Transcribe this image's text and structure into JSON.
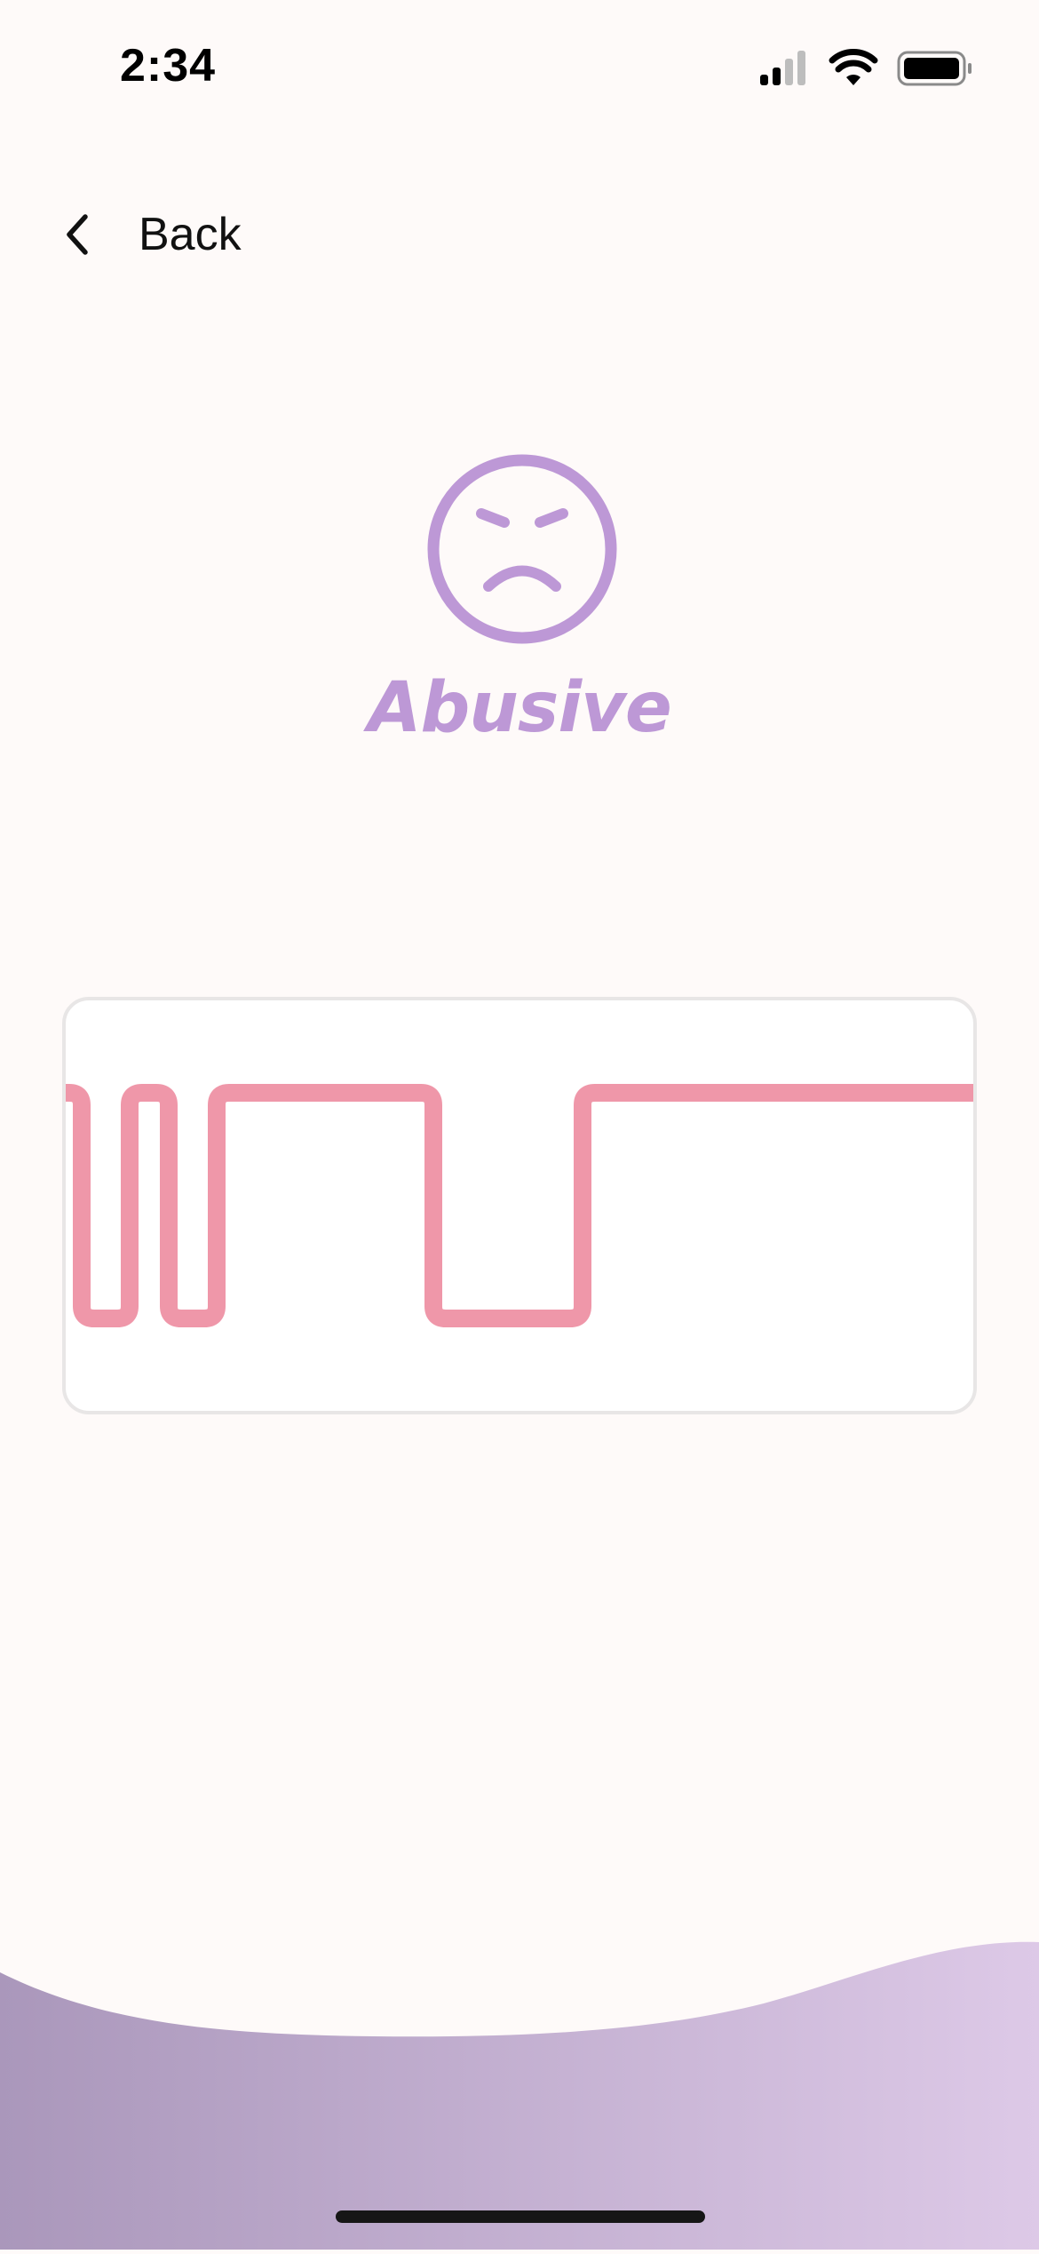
{
  "status_bar": {
    "time": "2:34"
  },
  "nav": {
    "back_label": "Back"
  },
  "mood": {
    "title": "Abusive",
    "icon": "angry-face-icon",
    "color": "#bd98d6"
  },
  "pattern": {
    "line_color": "#ef97a9",
    "card_border_color": "#e8e6e6",
    "description": "vibration pattern: high/low square wave",
    "levels": [
      "high",
      "low",
      "high",
      "low",
      "high",
      "low",
      "high"
    ],
    "durations": [
      1,
      2,
      1,
      2,
      8,
      6,
      2
    ]
  },
  "background": {
    "wave_gradient_start": "#aa97bb",
    "wave_gradient_end": "#ddc9e7"
  }
}
